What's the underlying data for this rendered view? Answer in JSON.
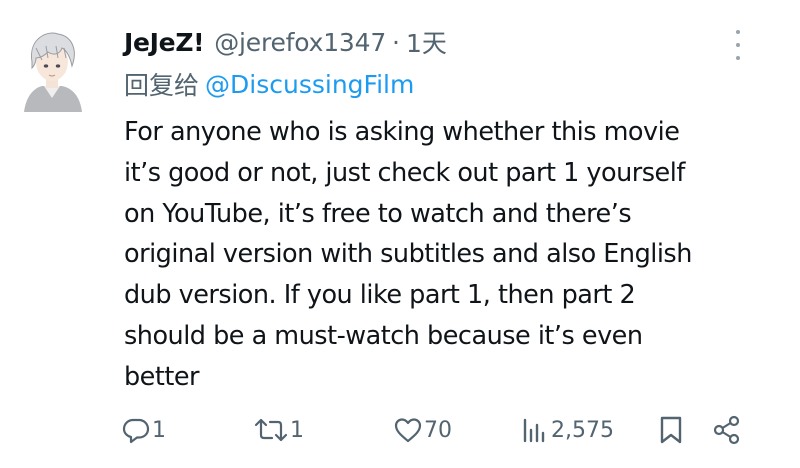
{
  "author": {
    "display_name": "JeJeZ!",
    "handle": "@jerefox1347",
    "separator": "·",
    "time": "1天",
    "avatar_icon": "anime-avatar-icon"
  },
  "reply_to": {
    "prefix": "回复给",
    "mention": "@DiscussingFilm"
  },
  "text_lines": [
    "For anyone who is asking whether this movie",
    "it’s good or not, just check out part 1 yourself",
    "on YouTube, it’s free to watch and there’s",
    "original version with subtitles and also English",
    "dub version. If you like part 1, then part 2",
    "should be a must-watch because it’s even",
    "better"
  ],
  "actions": {
    "replies": "1",
    "reposts": "1",
    "likes": "70",
    "views": "2,575"
  },
  "colors": {
    "text": "#0f1419",
    "secondary": "#536471",
    "link": "#1d9bf0"
  }
}
